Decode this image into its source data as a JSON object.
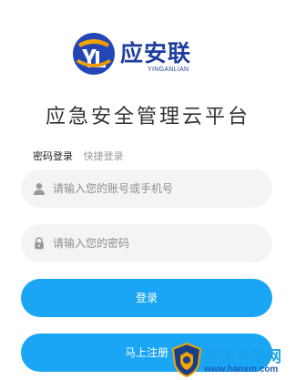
{
  "logo": {
    "name": "应安联",
    "subtitle": "YINGANLIAN",
    "icon": "yal-emblem-icon"
  },
  "title": "应急安全管理云平台",
  "tabs": [
    {
      "label": "密码登录",
      "active": true
    },
    {
      "label": "快捷登录",
      "active": false
    }
  ],
  "account": {
    "placeholder": "请输入您的账号或手机号",
    "icon": "user-icon"
  },
  "password": {
    "placeholder": "请输入您的密码",
    "icon": "lock-icon"
  },
  "buttons": {
    "login": "登录",
    "register": "马上注册"
  },
  "watermark": {
    "name": "西美手游网",
    "url": "www.hanxm.com"
  },
  "colors": {
    "primary": "#1aa5f5",
    "brand": "#1f3e9e",
    "field_bg": "#f4f4f6"
  }
}
